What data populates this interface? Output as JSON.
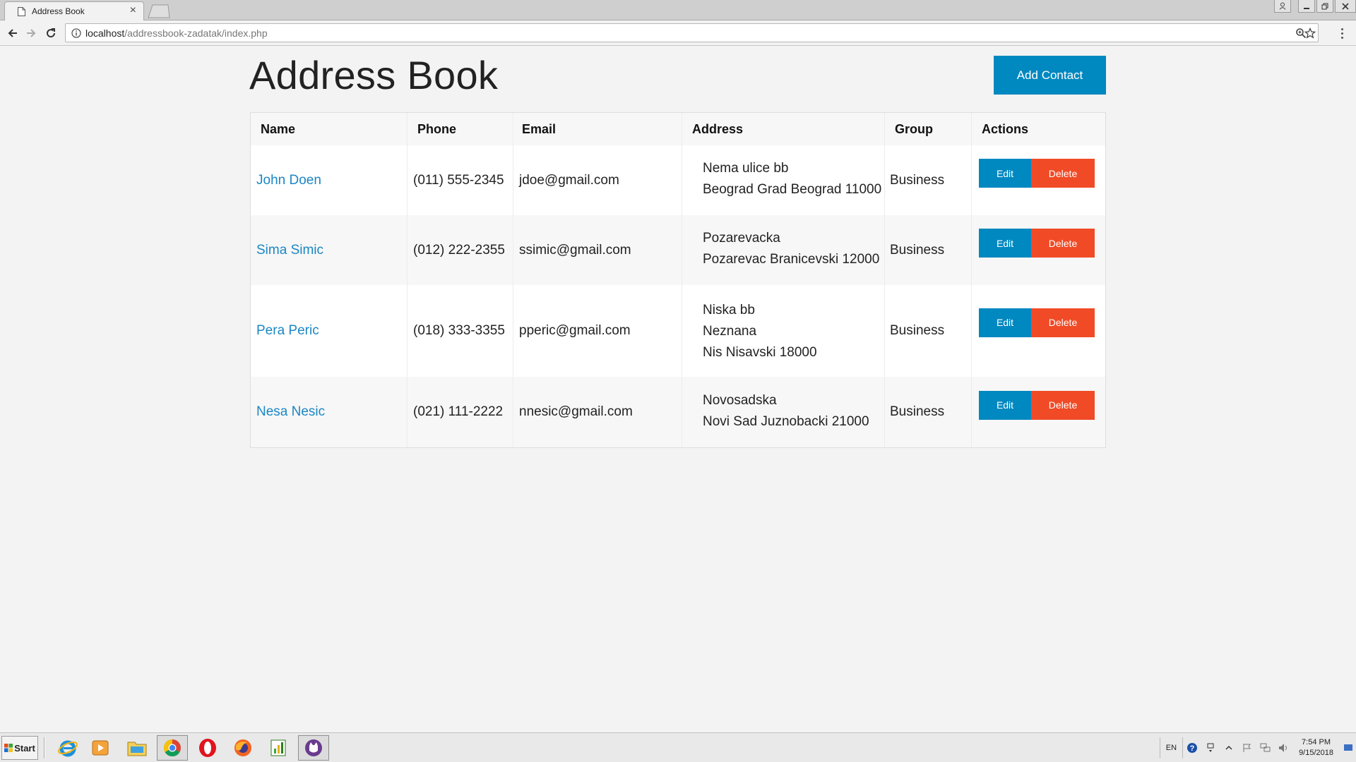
{
  "browser": {
    "tab_title": "Address Book",
    "tab_close": "×",
    "url_host": "localhost",
    "url_path": "/addressbook-zadatak/index.php"
  },
  "page": {
    "title": "Address Book",
    "add_button": "Add Contact"
  },
  "table": {
    "headers": {
      "name": "Name",
      "phone": "Phone",
      "email": "Email",
      "address": "Address",
      "group": "Group",
      "actions": "Actions"
    },
    "rows": [
      {
        "name": "John Doen",
        "phone": "(011) 555-2345",
        "email": "jdoe@gmail.com",
        "address": [
          "Nema ulice bb",
          "Beograd Grad Beograd 11000"
        ],
        "group": "Business",
        "edit": "Edit",
        "delete": "Delete"
      },
      {
        "name": "Sima Simic",
        "phone": "(012) 222-2355",
        "email": "ssimic@gmail.com",
        "address": [
          "Pozarevacka",
          "Pozarevac Branicevski 12000"
        ],
        "group": "Business",
        "edit": "Edit",
        "delete": "Delete"
      },
      {
        "name": "Pera Peric",
        "phone": "(018) 333-3355",
        "email": "pperic@gmail.com",
        "address": [
          "Niska bb",
          "Neznana",
          "Nis Nisavski 18000"
        ],
        "group": "Business",
        "edit": "Edit",
        "delete": "Delete"
      },
      {
        "name": "Nesa Nesic",
        "phone": "(021) 111-2222",
        "email": "nnesic@gmail.com",
        "address": [
          "Novosadska",
          "Novi Sad Juznobacki 21000"
        ],
        "group": "Business",
        "edit": "Edit",
        "delete": "Delete"
      }
    ]
  },
  "taskbar": {
    "start_label": "Start",
    "apps": [
      "internet-explorer-icon",
      "media-player-icon",
      "file-explorer-icon",
      "chrome-icon",
      "opera-icon",
      "firefox-icon",
      "sheet-app-icon",
      "purple-app-icon"
    ],
    "language": "EN",
    "time": "7:54 PM",
    "date": "9/15/2018"
  },
  "colors": {
    "primary": "#0088c0",
    "danger": "#f04b26",
    "link": "#1a87c4",
    "page_bg": "#f3f3f3"
  }
}
